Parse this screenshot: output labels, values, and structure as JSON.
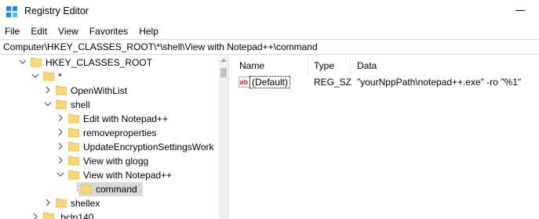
{
  "window": {
    "title": "Registry Editor"
  },
  "menu": [
    "File",
    "Edit",
    "View",
    "Favorites",
    "Help"
  ],
  "address": "Computer\\HKEY_CLASSES_ROOT\\*\\shell\\View with Notepad++\\command",
  "tree": {
    "nodes": [
      {
        "label": "HKEY_CLASSES_ROOT",
        "expanded": true
      },
      {
        "label": "*",
        "expanded": true
      },
      {
        "label": "OpenWithList",
        "expanded": false
      },
      {
        "label": "shell",
        "expanded": true
      },
      {
        "label": "Edit with Notepad++",
        "expanded": false
      },
      {
        "label": "removeproperties",
        "expanded": false
      },
      {
        "label": "UpdateEncryptionSettingsWork",
        "expanded": false
      },
      {
        "label": "View with glogg",
        "expanded": false
      },
      {
        "label": "View with Notepad++",
        "expanded": true
      },
      {
        "label": "command",
        "selected": true
      },
      {
        "label": "shellex",
        "expanded": false
      },
      {
        "label": ".bclp140",
        "expanded": false
      }
    ]
  },
  "list": {
    "columns": {
      "name": "Name",
      "type": "Type",
      "data": "Data"
    },
    "rows": [
      {
        "icon": "string-value-icon",
        "name": "(Default)",
        "type": "REG_SZ",
        "data": "\"yourNppPath\\notepad++.exe\" -ro \"%1\""
      }
    ]
  },
  "colors": {
    "folder": "#f8d775",
    "folder_dark": "#dcb24a",
    "selection": "#d9d9d9",
    "icon_blue": "#1e88e5"
  }
}
